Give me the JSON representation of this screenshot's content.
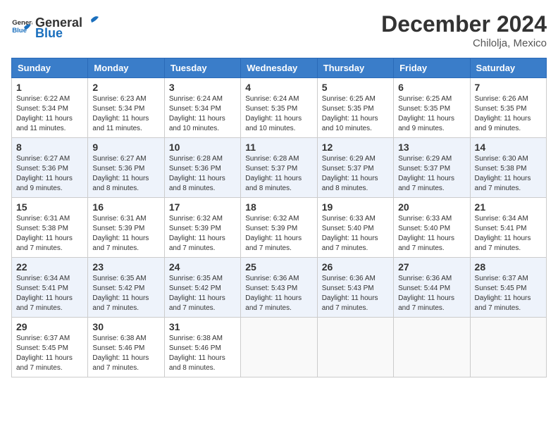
{
  "header": {
    "logo_general": "General",
    "logo_blue": "Blue",
    "month_title": "December 2024",
    "location": "Chilolja, Mexico"
  },
  "days_of_week": [
    "Sunday",
    "Monday",
    "Tuesday",
    "Wednesday",
    "Thursday",
    "Friday",
    "Saturday"
  ],
  "weeks": [
    [
      {
        "day": "1",
        "sunrise": "6:22 AM",
        "sunset": "5:34 PM",
        "daylight": "11 hours and 11 minutes."
      },
      {
        "day": "2",
        "sunrise": "6:23 AM",
        "sunset": "5:34 PM",
        "daylight": "11 hours and 11 minutes."
      },
      {
        "day": "3",
        "sunrise": "6:24 AM",
        "sunset": "5:34 PM",
        "daylight": "11 hours and 10 minutes."
      },
      {
        "day": "4",
        "sunrise": "6:24 AM",
        "sunset": "5:35 PM",
        "daylight": "11 hours and 10 minutes."
      },
      {
        "day": "5",
        "sunrise": "6:25 AM",
        "sunset": "5:35 PM",
        "daylight": "11 hours and 10 minutes."
      },
      {
        "day": "6",
        "sunrise": "6:25 AM",
        "sunset": "5:35 PM",
        "daylight": "11 hours and 9 minutes."
      },
      {
        "day": "7",
        "sunrise": "6:26 AM",
        "sunset": "5:35 PM",
        "daylight": "11 hours and 9 minutes."
      }
    ],
    [
      {
        "day": "8",
        "sunrise": "6:27 AM",
        "sunset": "5:36 PM",
        "daylight": "11 hours and 9 minutes."
      },
      {
        "day": "9",
        "sunrise": "6:27 AM",
        "sunset": "5:36 PM",
        "daylight": "11 hours and 8 minutes."
      },
      {
        "day": "10",
        "sunrise": "6:28 AM",
        "sunset": "5:36 PM",
        "daylight": "11 hours and 8 minutes."
      },
      {
        "day": "11",
        "sunrise": "6:28 AM",
        "sunset": "5:37 PM",
        "daylight": "11 hours and 8 minutes."
      },
      {
        "day": "12",
        "sunrise": "6:29 AM",
        "sunset": "5:37 PM",
        "daylight": "11 hours and 8 minutes."
      },
      {
        "day": "13",
        "sunrise": "6:29 AM",
        "sunset": "5:37 PM",
        "daylight": "11 hours and 7 minutes."
      },
      {
        "day": "14",
        "sunrise": "6:30 AM",
        "sunset": "5:38 PM",
        "daylight": "11 hours and 7 minutes."
      }
    ],
    [
      {
        "day": "15",
        "sunrise": "6:31 AM",
        "sunset": "5:38 PM",
        "daylight": "11 hours and 7 minutes."
      },
      {
        "day": "16",
        "sunrise": "6:31 AM",
        "sunset": "5:39 PM",
        "daylight": "11 hours and 7 minutes."
      },
      {
        "day": "17",
        "sunrise": "6:32 AM",
        "sunset": "5:39 PM",
        "daylight": "11 hours and 7 minutes."
      },
      {
        "day": "18",
        "sunrise": "6:32 AM",
        "sunset": "5:39 PM",
        "daylight": "11 hours and 7 minutes."
      },
      {
        "day": "19",
        "sunrise": "6:33 AM",
        "sunset": "5:40 PM",
        "daylight": "11 hours and 7 minutes."
      },
      {
        "day": "20",
        "sunrise": "6:33 AM",
        "sunset": "5:40 PM",
        "daylight": "11 hours and 7 minutes."
      },
      {
        "day": "21",
        "sunrise": "6:34 AM",
        "sunset": "5:41 PM",
        "daylight": "11 hours and 7 minutes."
      }
    ],
    [
      {
        "day": "22",
        "sunrise": "6:34 AM",
        "sunset": "5:41 PM",
        "daylight": "11 hours and 7 minutes."
      },
      {
        "day": "23",
        "sunrise": "6:35 AM",
        "sunset": "5:42 PM",
        "daylight": "11 hours and 7 minutes."
      },
      {
        "day": "24",
        "sunrise": "6:35 AM",
        "sunset": "5:42 PM",
        "daylight": "11 hours and 7 minutes."
      },
      {
        "day": "25",
        "sunrise": "6:36 AM",
        "sunset": "5:43 PM",
        "daylight": "11 hours and 7 minutes."
      },
      {
        "day": "26",
        "sunrise": "6:36 AM",
        "sunset": "5:43 PM",
        "daylight": "11 hours and 7 minutes."
      },
      {
        "day": "27",
        "sunrise": "6:36 AM",
        "sunset": "5:44 PM",
        "daylight": "11 hours and 7 minutes."
      },
      {
        "day": "28",
        "sunrise": "6:37 AM",
        "sunset": "5:45 PM",
        "daylight": "11 hours and 7 minutes."
      }
    ],
    [
      {
        "day": "29",
        "sunrise": "6:37 AM",
        "sunset": "5:45 PM",
        "daylight": "11 hours and 7 minutes."
      },
      {
        "day": "30",
        "sunrise": "6:38 AM",
        "sunset": "5:46 PM",
        "daylight": "11 hours and 7 minutes."
      },
      {
        "day": "31",
        "sunrise": "6:38 AM",
        "sunset": "5:46 PM",
        "daylight": "11 hours and 8 minutes."
      },
      null,
      null,
      null,
      null
    ]
  ],
  "labels": {
    "sunrise": "Sunrise:",
    "sunset": "Sunset:",
    "daylight": "Daylight:"
  }
}
